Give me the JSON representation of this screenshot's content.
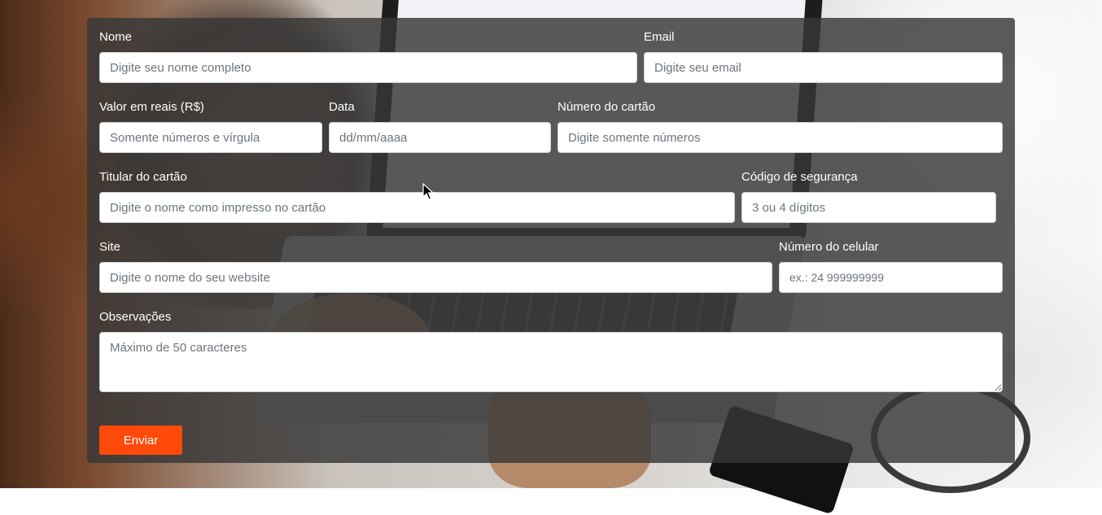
{
  "form": {
    "nome": {
      "label": "Nome",
      "placeholder": "Digite seu nome completo"
    },
    "email": {
      "label": "Email",
      "placeholder": "Digite seu email"
    },
    "valor": {
      "label": "Valor em reais (R$)",
      "placeholder": "Somente números e vírgula"
    },
    "data": {
      "label": "Data",
      "placeholder": "dd/mm/aaaa"
    },
    "numero_cartao": {
      "label": "Número do cartão",
      "placeholder": "Digite somente números"
    },
    "titular": {
      "label": "Titular do cartão",
      "placeholder": "Digite o nome como impresso no cartão"
    },
    "codigo": {
      "label": "Código de segurança",
      "placeholder": "3 ou 4 dígitos"
    },
    "site": {
      "label": "Site",
      "placeholder": "Digite o nome do seu website"
    },
    "celular": {
      "label": "Número do celular",
      "placeholder": "ex.: 24 999999999"
    },
    "observacoes": {
      "label": "Observações",
      "placeholder": "Máximo de 50 caracteres"
    },
    "submit_label": "Enviar"
  },
  "colors": {
    "panel": "#373737",
    "button": "#ff4a0a",
    "label_text": "#ffffff"
  },
  "icons": {
    "cursor": "mouse-pointer-icon"
  }
}
